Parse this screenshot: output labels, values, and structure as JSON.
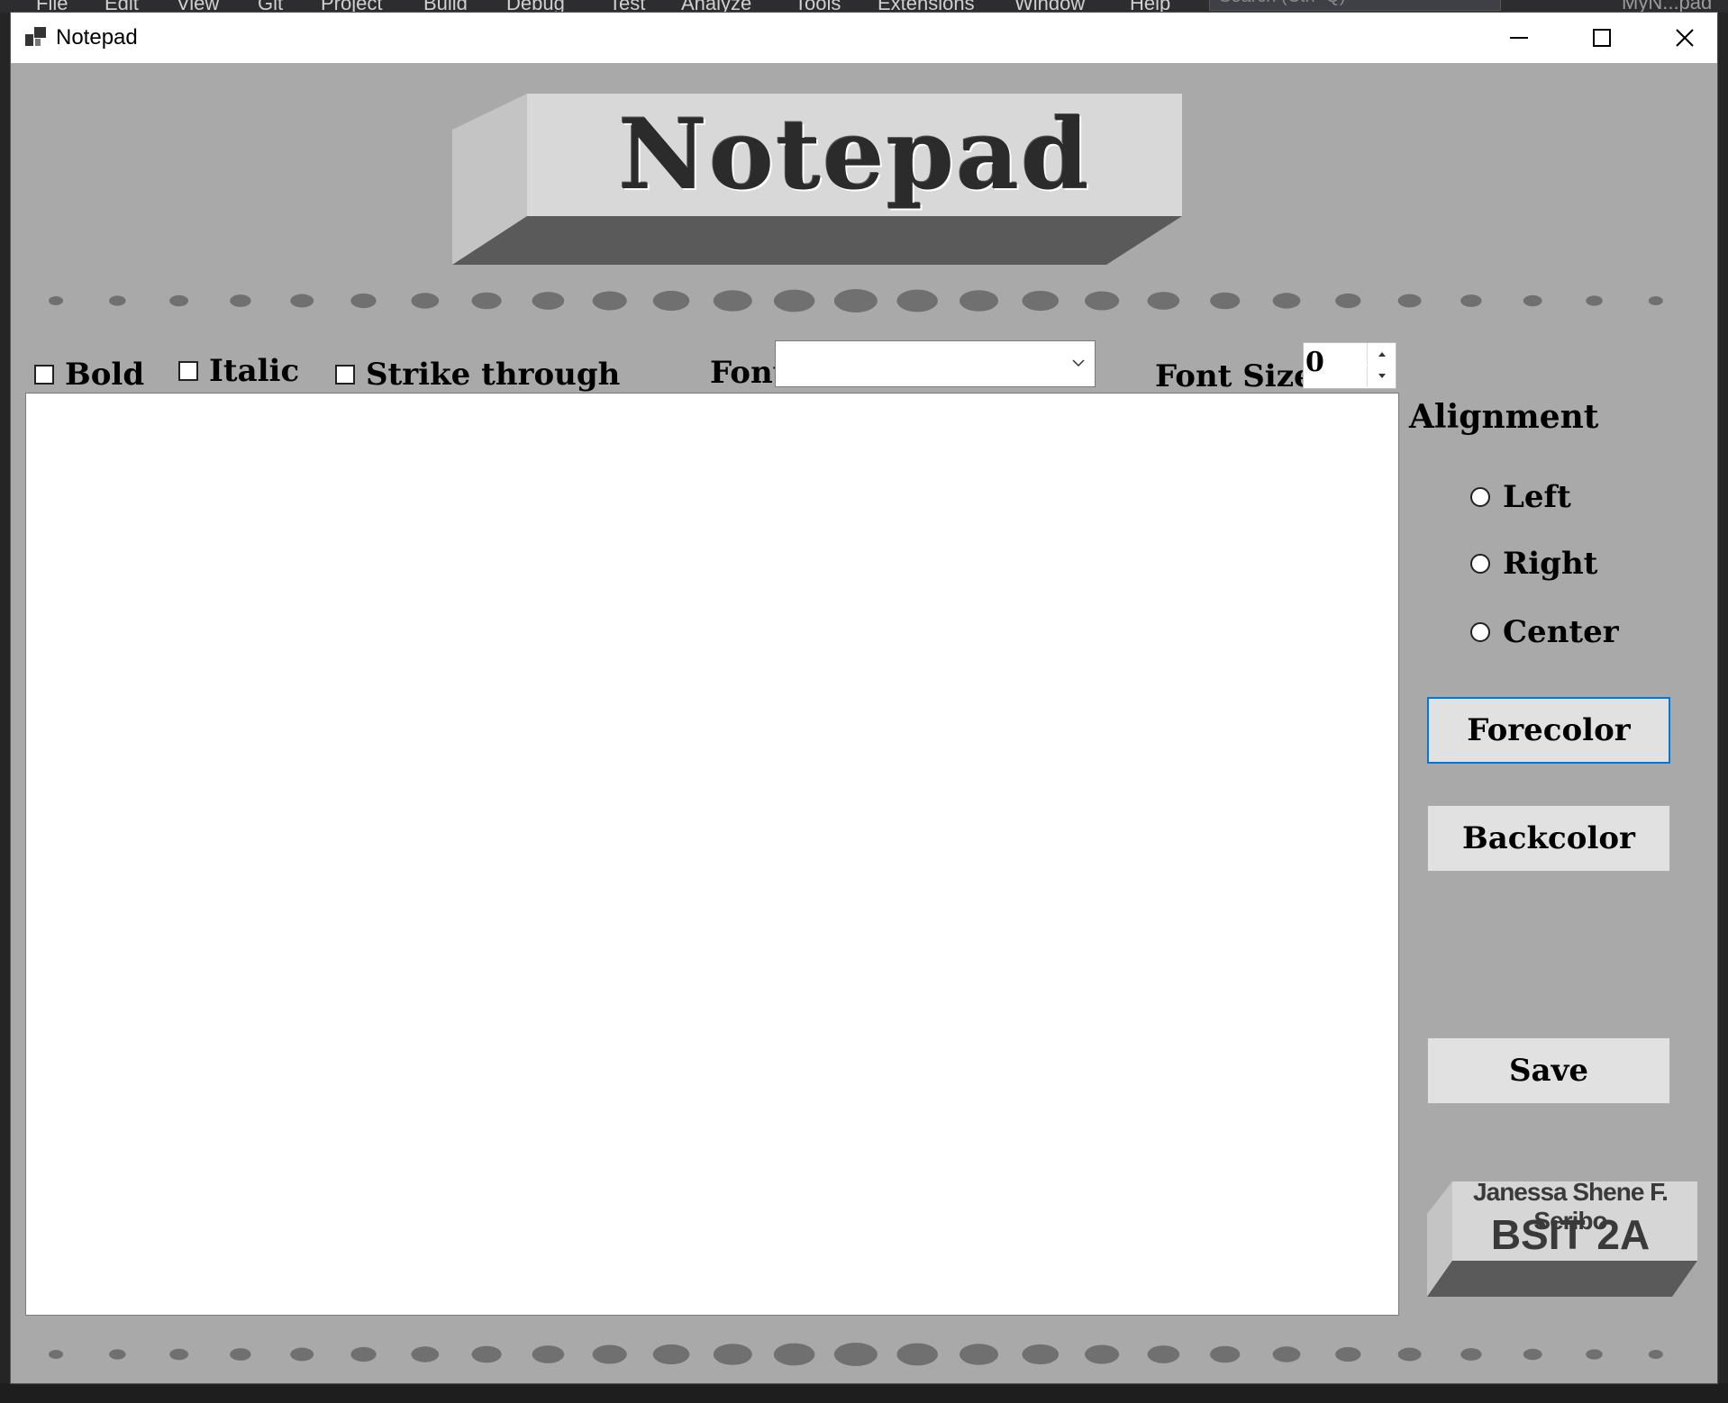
{
  "ide": {
    "menu": [
      "File",
      "Edit",
      "View",
      "Git",
      "Project",
      "Build",
      "Debug",
      "Test",
      "Analyze",
      "Tools",
      "Extensions",
      "Window",
      "Help"
    ],
    "search_placeholder": "Search (Ctrl+Q)",
    "solution_title": "MyN...pad"
  },
  "window": {
    "title": "Notepad",
    "logo_text": "Notepad"
  },
  "toolbar": {
    "bold_label": "Bold",
    "italic_label": "Italic",
    "strike_label": "Strike through",
    "font_label": "Font",
    "font_value": "",
    "font_size_label": "Font Size",
    "font_size_value": "0"
  },
  "editor": {
    "value": ""
  },
  "alignment": {
    "title": "Alignment",
    "options": [
      "Left",
      "Right",
      "Center"
    ]
  },
  "buttons": {
    "forecolor": "Forecolor",
    "backcolor": "Backcolor",
    "save": "Save"
  },
  "signature": {
    "name": "Janessa Shene F. Seribo",
    "class": "BSIT 2A"
  },
  "colors": {
    "window_bg": "#a9a9a9",
    "dot": "#707070",
    "focus_border": "#0078d7"
  },
  "icons": [
    "app-icon",
    "minimize-icon",
    "maximize-icon",
    "close-icon",
    "chevron-down-icon",
    "spin-up-icon",
    "spin-down-icon"
  ]
}
